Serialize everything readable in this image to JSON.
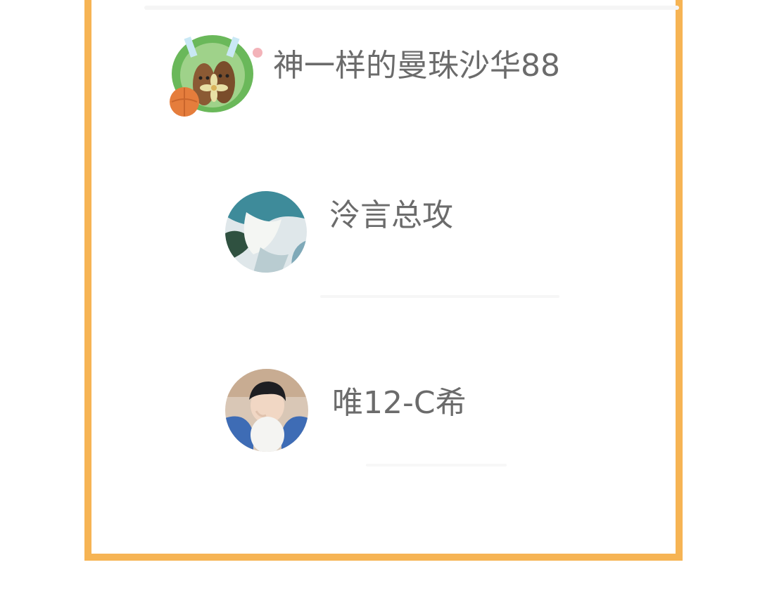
{
  "users": [
    {
      "name": "神一样的曼珠沙华88",
      "avatar": "kiwi-cartoon-avatar-icon"
    },
    {
      "name": "泠言总攻",
      "avatar": "landscape-photo-avatar-icon"
    },
    {
      "name": "唯12-C希",
      "avatar": "person-photo-avatar-icon"
    }
  ],
  "colors": {
    "border": "#f6b454",
    "text": "#6b6b6b",
    "background": "#ffffff"
  }
}
